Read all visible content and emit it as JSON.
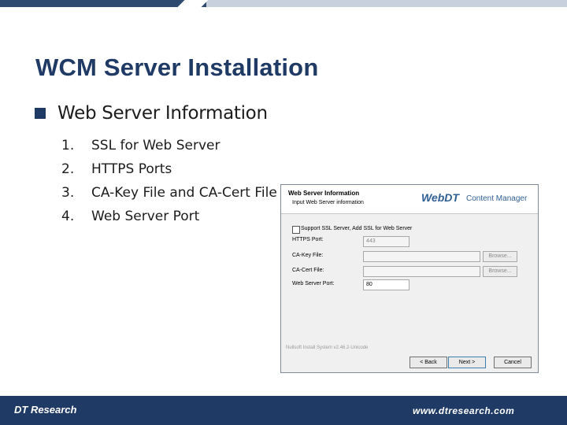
{
  "slide": {
    "title": "WCM Server Installation",
    "bullet": "Web Server Information",
    "items": [
      {
        "num": "1.",
        "text": "SSL for Web Server"
      },
      {
        "num": "2.",
        "text": "HTTPS Ports"
      },
      {
        "num": "3.",
        "text": "CA-Key File and CA-Cert File"
      },
      {
        "num": "4.",
        "text": "Web Server Port"
      }
    ]
  },
  "installer": {
    "header_title": "Web Server Information",
    "header_subtitle": "Input Web Server information",
    "logo_text": "WebDT",
    "logo_product": "Content Manager",
    "checkbox_label": "Support SSL Server, Add SSL for Web Server",
    "fields": {
      "https_label": "HTTPS Port:",
      "https_value": "443",
      "cakey_label": "CA-Key File:",
      "cacert_label": "CA-Cert File:",
      "webport_label": "Web Server Port:",
      "webport_value": "80"
    },
    "browse_label": "Browse...",
    "footer_text": "Nullsoft Install System v2.46.2-Unicode",
    "buttons": {
      "back": "< Back",
      "next": "Next >",
      "cancel": "Cancel"
    }
  },
  "footer": {
    "logo": "DT Research",
    "url": "www.dtresearch.com"
  },
  "colors": {
    "brand_navy": "#1f3a64",
    "accent_blue": "#2f5f93"
  }
}
